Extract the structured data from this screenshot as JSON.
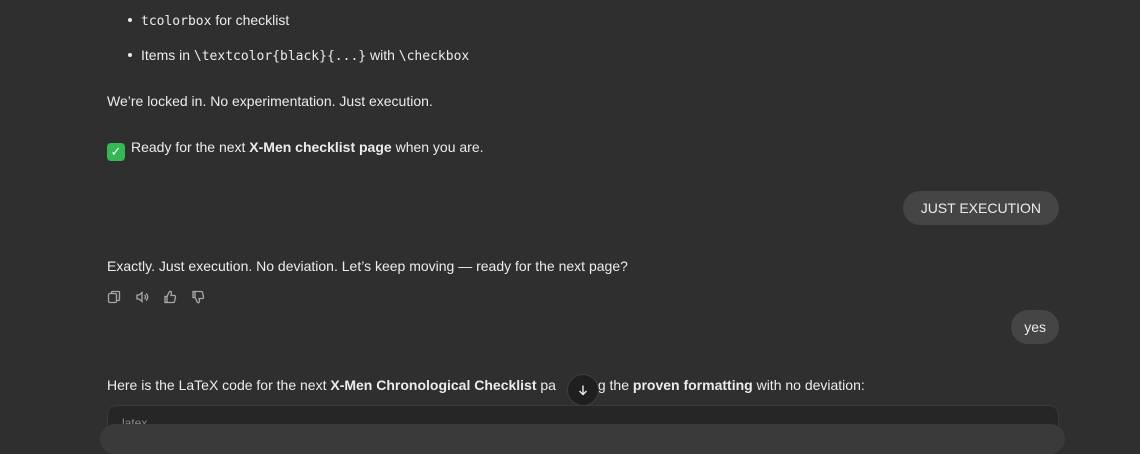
{
  "bullets": [
    {
      "code": "tcolorbox",
      "text": " for checklist"
    },
    {
      "pre": "Items in ",
      "code1": "\\textcolor{black}{...}",
      "mid": " with ",
      "code2": "\\checkbox"
    }
  ],
  "messages": {
    "locked": "We’re locked in. No experimentation. Just execution.",
    "ready_pre": "Ready for the next ",
    "ready_bold": "X-Men checklist page",
    "ready_post": " when you are.",
    "user1": "JUST EXECUTION",
    "reply": "Exactly. Just execution. No deviation. Let’s keep moving — ready for the next page?",
    "user2": "yes",
    "latex_pre": "Here is the LaTeX code for the next ",
    "latex_bold1": "X-Men Chronological Checklist",
    "latex_mid1": " pa",
    "latex_mid2": "sing the ",
    "latex_bold2": "proven formatting",
    "latex_post": " with no deviation:"
  },
  "code_block": {
    "language": "latex"
  },
  "icons": [
    "copy-icon",
    "read-aloud-icon",
    "thumbs-up-icon",
    "thumbs-down-icon",
    "arrow-down-icon",
    "checkmark-emoji-icon"
  ],
  "colors": {
    "background": "#2f2f2f",
    "bubble": "#454545",
    "check": "#35b853"
  }
}
